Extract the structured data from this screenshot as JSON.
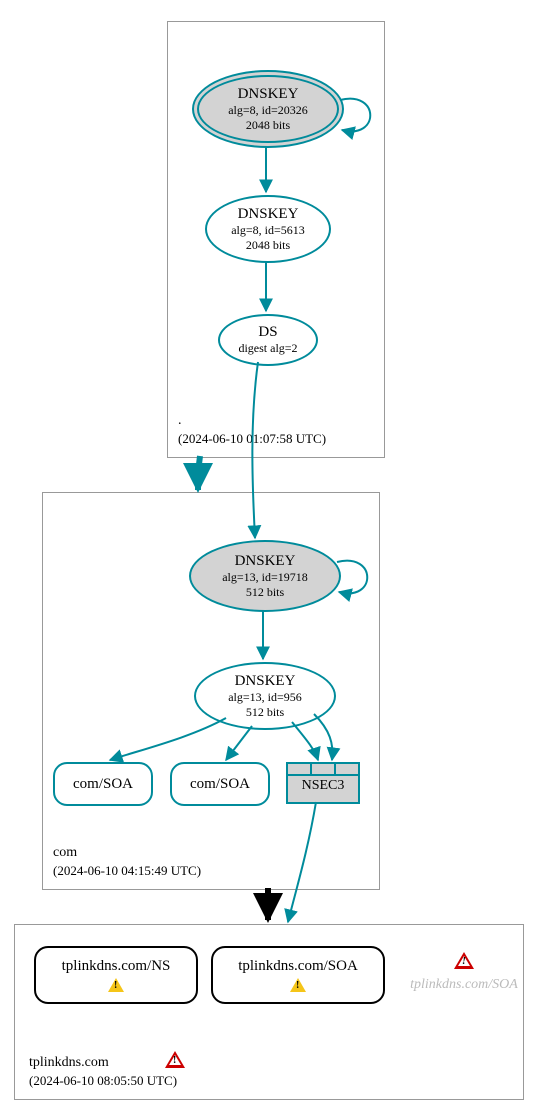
{
  "zones": {
    "root": {
      "label": ".",
      "date": "(2024-06-10 01:07:58 UTC)"
    },
    "com": {
      "label": "com",
      "date": "(2024-06-10 04:15:49 UTC)"
    },
    "tpl": {
      "label": "tplinkdns.com",
      "date": "(2024-06-10 08:05:50 UTC)"
    }
  },
  "nodes": {
    "root_ksk": {
      "title": "DNSKEY",
      "sub1": "alg=8, id=20326",
      "sub2": "2048 bits"
    },
    "root_zsk": {
      "title": "DNSKEY",
      "sub1": "alg=8, id=5613",
      "sub2": "2048 bits"
    },
    "root_ds": {
      "title": "DS",
      "sub1": "digest alg=2"
    },
    "com_ksk": {
      "title": "DNSKEY",
      "sub1": "alg=13, id=19718",
      "sub2": "512 bits"
    },
    "com_zsk": {
      "title": "DNSKEY",
      "sub1": "alg=13, id=956",
      "sub2": "512 bits"
    },
    "com_soa1": {
      "title": "com/SOA"
    },
    "com_soa2": {
      "title": "com/SOA"
    },
    "nsec3": {
      "title": "NSEC3"
    },
    "tpl_ns": {
      "title": "tplinkdns.com/NS"
    },
    "tpl_soa": {
      "title": "tplinkdns.com/SOA"
    },
    "tpl_soa_ghost": {
      "title": "tplinkdns.com/SOA"
    }
  }
}
